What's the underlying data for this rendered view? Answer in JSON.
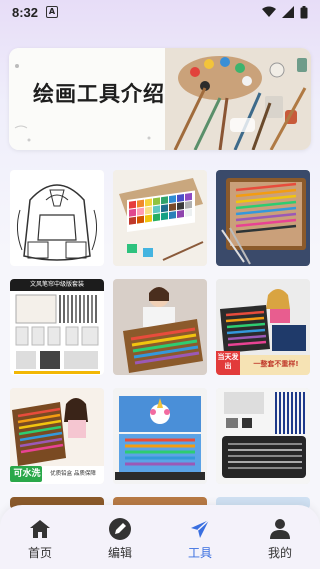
{
  "status_bar": {
    "time": "8:32",
    "badge": "A"
  },
  "banner": {
    "title": "绘画工具介绍"
  },
  "grid": {
    "tiles": [
      {
        "name": "backpack-sketch"
      },
      {
        "name": "gouache-paint-set"
      },
      {
        "name": "pencil-case-set"
      },
      {
        "name": "pen-set-product",
        "caption": "文风笔帘中级版套装"
      },
      {
        "name": "girl-with-art-case"
      },
      {
        "name": "kids-art-case",
        "caption1": "当天发出",
        "caption2": "一整套不重样!"
      },
      {
        "name": "washable-art-set",
        "caption1": "可水洗",
        "caption2": "优质铅盒 品质保障"
      },
      {
        "name": "unicorn-art-case"
      },
      {
        "name": "sketch-pencil-set"
      }
    ]
  },
  "bottom_nav": {
    "items": [
      {
        "label": "首页",
        "icon": "home-icon"
      },
      {
        "label": "编辑",
        "icon": "edit-icon"
      },
      {
        "label": "工具",
        "icon": "plane-icon",
        "active": true
      },
      {
        "label": "我的",
        "icon": "person-icon"
      }
    ],
    "active_color": "#3a6fe0"
  }
}
